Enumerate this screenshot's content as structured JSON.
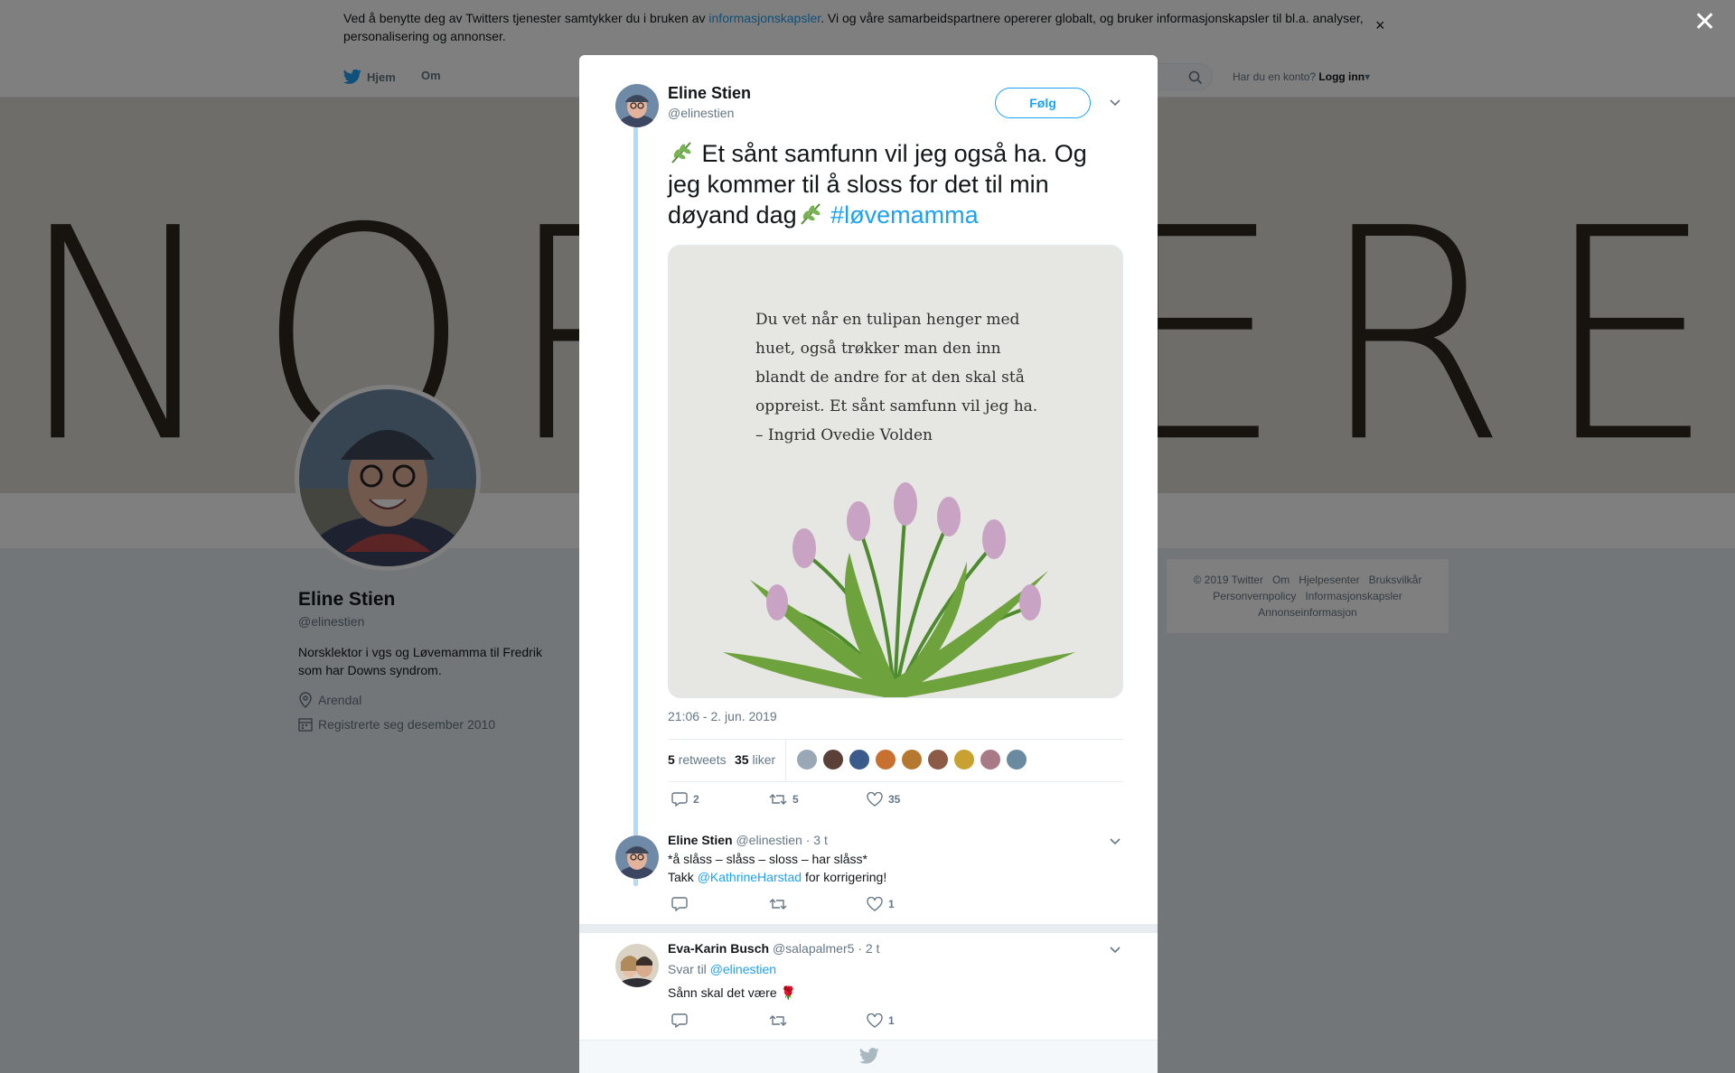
{
  "cookie": {
    "text_before": "Ved å benytte deg av Twitters tjenester samtykker du i bruken av ",
    "link": "informasjonskapsler",
    "text_after": ". Vi og våre samarbeidspartnere opererer globalt, og bruker informasjonskapsler til bl.a. analyser, personalisering og annonser.",
    "close": "×"
  },
  "nav": {
    "home": "Hjem",
    "about": "Om",
    "account_prompt": "Har du en konto?",
    "login": "Logg inn"
  },
  "banner": {
    "left": "NORS",
    "right": "EREN"
  },
  "profile": {
    "name": "Eline Stien",
    "handle": "@elinestien",
    "bio": "Norsklektor i vgs og Løvemamma til Fredrik som har Downs syndrom.",
    "location": "Arendal",
    "joined": "Registrerte seg desember 2010"
  },
  "footer": {
    "links": [
      "© 2019 Twitter",
      "Om",
      "Hjelpesenter",
      "Bruksvilkår",
      "Personvernpolicy",
      "Informasjonskapsler",
      "Annonseinformasjon"
    ]
  },
  "overlay": {
    "close": "✕"
  },
  "tweet": {
    "name": "Eline Stien",
    "handle": "@elinestien",
    "follow": "Følg",
    "text_part1": " Et sånt samfunn vil jeg også ha. Og jeg kommer til å sloss for det til min døyand dag",
    "hashtag": "#løvemamma",
    "quote_lines": [
      "Du vet når en tulipan henger med",
      "huet, også trøkker man den inn",
      "blandt de andre for at den skal stå",
      "oppreist. Et sånt samfunn vil jeg ha.",
      "– Ingrid Ovedie Volden"
    ],
    "timestamp": "21:06 - 2. jun. 2019",
    "retweets_count": "5",
    "retweets_label": "retweets",
    "likes_count": "35",
    "likes_label": "liker",
    "replies": "2",
    "retweets_action": "5",
    "likes_action": "35",
    "liker_colors": [
      "#9aa7b4",
      "#5a4036",
      "#3b5b8c",
      "#c7702f",
      "#b5782f",
      "#8d5a45",
      "#c9a130",
      "#a87a86",
      "#6a8aa0"
    ]
  },
  "replies": [
    {
      "name": "Eline Stien",
      "handle": "@elinestien",
      "time": "· 3 t",
      "line1": "*å slåss – slåss – sloss – har slåss*",
      "line2_before": "Takk ",
      "mention": "@KathrineHarstad",
      "line2_after": " for korrigering!",
      "likes": "1"
    },
    {
      "name": "Eva-Karin Busch",
      "handle": "@salapalmer5",
      "time": "· 2 t",
      "reply_to_label": "Svar til ",
      "reply_to": "@elinestien",
      "text": "Sånn skal det være 🌹",
      "likes": "1"
    }
  ],
  "colors": {
    "accent": "#1da1f2",
    "thread": "#b0dcf7",
    "muted": "#657786"
  }
}
